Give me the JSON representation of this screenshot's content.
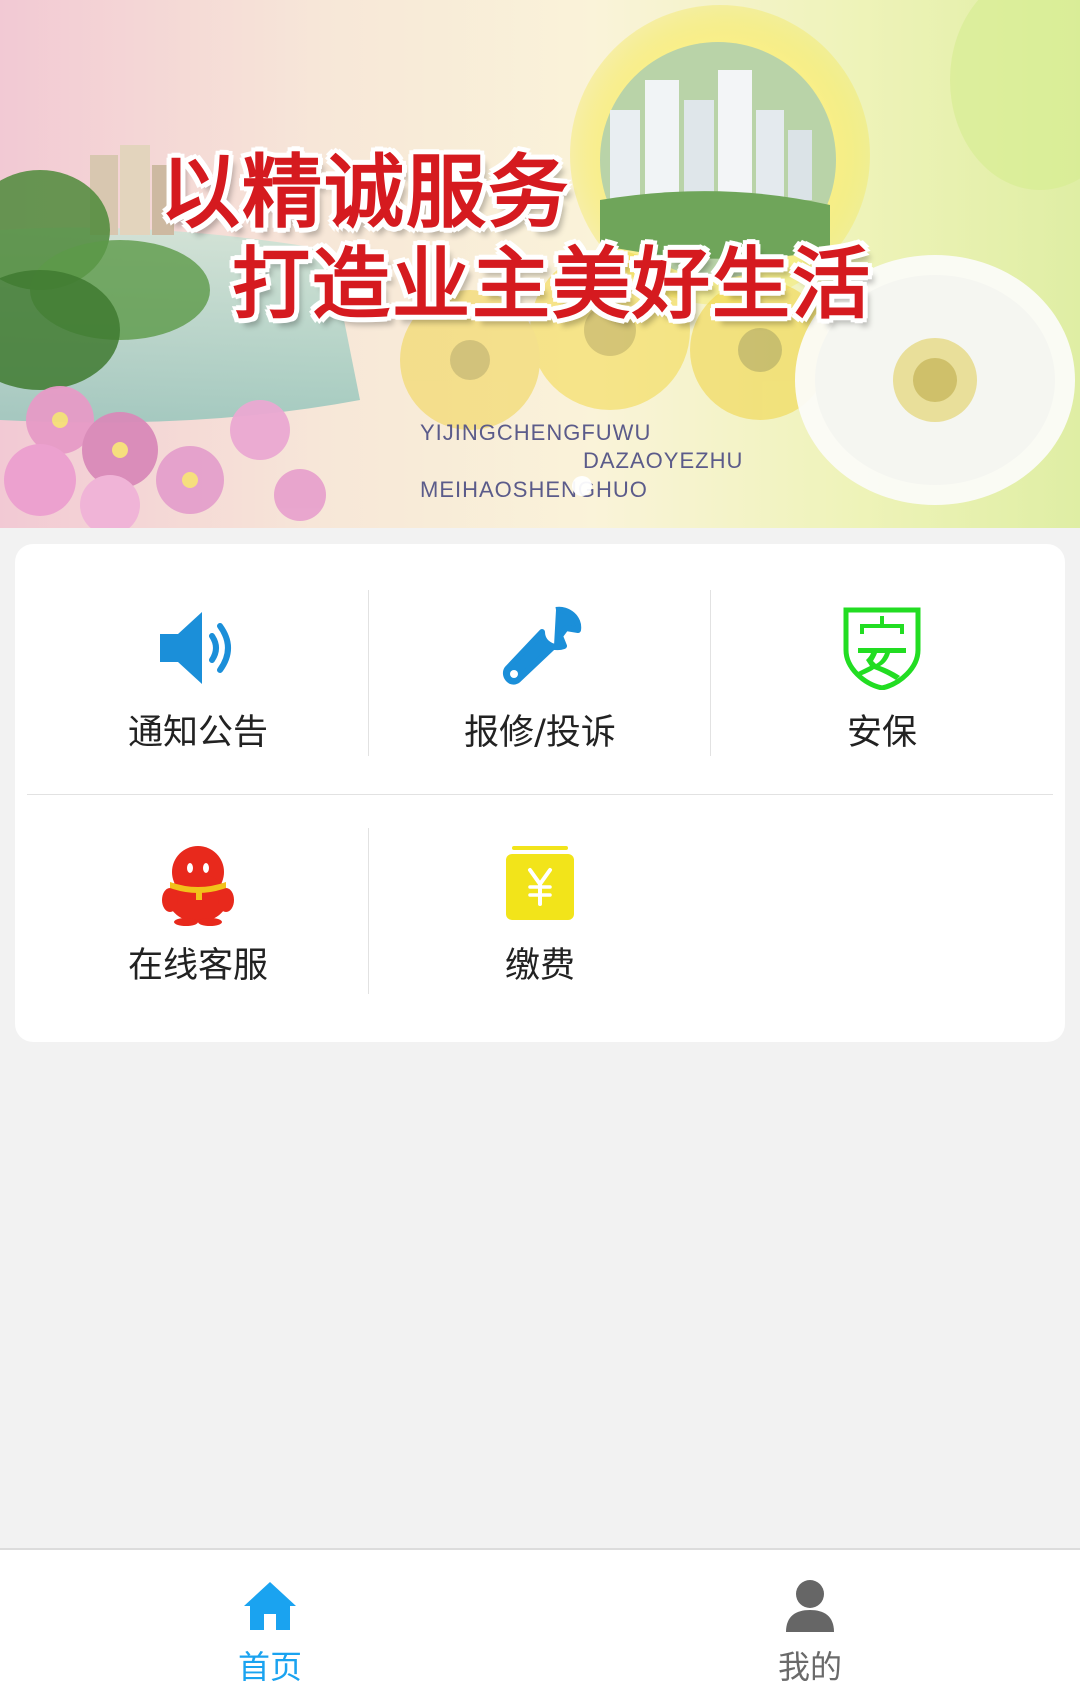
{
  "banner": {
    "slogan_line1": "以精诚服务",
    "slogan_line2": "打造业主美好生活",
    "pinyin_line1": "YIJINGCHENGFUWU",
    "pinyin_line2": "DAZAOYEZHU",
    "pinyin_line3": "MEIHAOSHENGHUO"
  },
  "menu": {
    "items": [
      {
        "label": "通知公告",
        "icon": "speaker-icon",
        "color": "#1b8fd9"
      },
      {
        "label": "报修/投诉",
        "icon": "wrench-icon",
        "color": "#1b8fd9"
      },
      {
        "label": "安保",
        "icon": "security-shield-icon",
        "color": "#22dd22"
      },
      {
        "label": "在线客服",
        "icon": "qq-penguin-icon",
        "color": "#e8291c"
      },
      {
        "label": "缴费",
        "icon": "payment-yuan-icon",
        "color": "#f2e41a"
      }
    ]
  },
  "tabbar": {
    "home_label": "首页",
    "mine_label": "我的",
    "active_color": "#1aa3f0",
    "inactive_color": "#6a6a6a"
  }
}
